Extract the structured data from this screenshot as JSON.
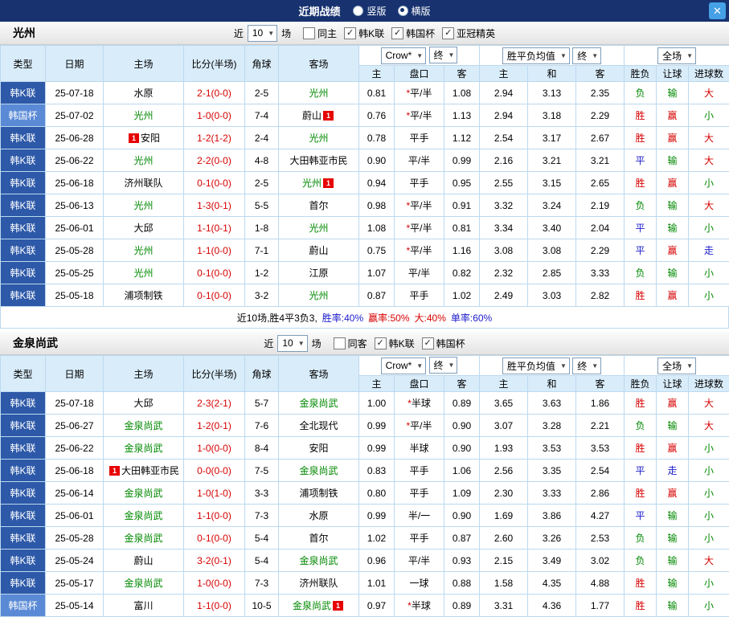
{
  "icons": {
    "chevron_down": "▼",
    "close": "✕",
    "check": "✓"
  },
  "colors": {
    "topbar_bg": "#17326f",
    "close_btn": "#45a0e6",
    "header_bg": "#d9ecfa",
    "border": "#bcd9ef",
    "league": {
      "韩K联": "#2d59a8",
      "韩国杯": "#5a8ad6"
    },
    "team_highlight": "#008800",
    "score": "#d60000",
    "card_badge": "#e60000",
    "outcome": {
      "胜": "#d60000",
      "赢": "#d60000",
      "大": "#d60000",
      "平": "#1b1bcc",
      "走": "#1b1bcc",
      "负": "#008800",
      "输": "#008800",
      "小": "#008800"
    }
  },
  "topbar": {
    "title": "近期战绩",
    "layout_options": [
      {
        "label": "竖版",
        "selected": false
      },
      {
        "label": "横版",
        "selected": true
      }
    ],
    "close_label": "✕"
  },
  "table_header": {
    "main_columns": [
      "类型",
      "日期",
      "主场",
      "比分(半场)",
      "角球",
      "客场"
    ],
    "sub_columns": [
      "主",
      "盘口",
      "客",
      "主",
      "和",
      "客",
      "胜负",
      "让球",
      "进球数"
    ]
  },
  "sections": [
    {
      "team": "光州",
      "filter": {
        "prefix": "近",
        "count": "10",
        "suffix": "场",
        "checkboxes": [
          {
            "label": "同主",
            "checked": false
          },
          {
            "label": "韩K联",
            "checked": true
          },
          {
            "label": "韩国杯",
            "checked": true
          },
          {
            "label": "亚冠精英",
            "checked": true
          }
        ]
      },
      "controls": {
        "odds_company": "Crow*",
        "odds_stage": "终",
        "avg_label": "胜平负均值",
        "avg_stage": "终",
        "scope": "全场"
      },
      "rows": [
        {
          "league": "韩K联",
          "date": "25-07-18",
          "home": {
            "name": "水原",
            "hl": false
          },
          "score": "2-1(0-0)",
          "corners": "2-5",
          "away": {
            "name": "光州",
            "hl": true
          },
          "odds": [
            "0.81",
            "*平/半",
            "1.08"
          ],
          "avg": [
            "2.94",
            "3.13",
            "2.35"
          ],
          "outcome": [
            "负",
            "输",
            "大"
          ]
        },
        {
          "league": "韩国杯",
          "date": "25-07-02",
          "home": {
            "name": "光州",
            "hl": true
          },
          "score": "1-0(0-0)",
          "corners": "7-4",
          "away": {
            "name": "蔚山",
            "hl": false,
            "card": "1",
            "card_pos": "after"
          },
          "odds": [
            "0.76",
            "*平/半",
            "1.13"
          ],
          "avg": [
            "2.94",
            "3.18",
            "2.29"
          ],
          "outcome": [
            "胜",
            "赢",
            "小"
          ]
        },
        {
          "league": "韩K联",
          "date": "25-06-28",
          "home": {
            "name": "安阳",
            "hl": false,
            "card": "1",
            "card_pos": "before"
          },
          "score": "1-2(1-2)",
          "corners": "2-4",
          "away": {
            "name": "光州",
            "hl": true
          },
          "odds": [
            "0.78",
            "平手",
            "1.12"
          ],
          "avg": [
            "2.54",
            "3.17",
            "2.67"
          ],
          "outcome": [
            "胜",
            "赢",
            "大"
          ]
        },
        {
          "league": "韩K联",
          "date": "25-06-22",
          "home": {
            "name": "光州",
            "hl": true
          },
          "score": "2-2(0-0)",
          "corners": "4-8",
          "away": {
            "name": "大田韩亚市民",
            "hl": false
          },
          "odds": [
            "0.90",
            "平/半",
            "0.99"
          ],
          "avg": [
            "2.16",
            "3.21",
            "3.21"
          ],
          "outcome": [
            "平",
            "输",
            "大"
          ]
        },
        {
          "league": "韩K联",
          "date": "25-06-18",
          "home": {
            "name": "济州联队",
            "hl": false
          },
          "score": "0-1(0-0)",
          "corners": "2-5",
          "away": {
            "name": "光州",
            "hl": true,
            "card": "1",
            "card_pos": "after"
          },
          "odds": [
            "0.94",
            "平手",
            "0.95"
          ],
          "avg": [
            "2.55",
            "3.15",
            "2.65"
          ],
          "outcome": [
            "胜",
            "赢",
            "小"
          ]
        },
        {
          "league": "韩K联",
          "date": "25-06-13",
          "home": {
            "name": "光州",
            "hl": true
          },
          "score": "1-3(0-1)",
          "corners": "5-5",
          "away": {
            "name": "首尔",
            "hl": false
          },
          "odds": [
            "0.98",
            "*平/半",
            "0.91"
          ],
          "avg": [
            "3.32",
            "3.24",
            "2.19"
          ],
          "outcome": [
            "负",
            "输",
            "大"
          ]
        },
        {
          "league": "韩K联",
          "date": "25-06-01",
          "home": {
            "name": "大邱",
            "hl": false
          },
          "score": "1-1(0-1)",
          "corners": "1-8",
          "away": {
            "name": "光州",
            "hl": true
          },
          "odds": [
            "1.08",
            "*平/半",
            "0.81"
          ],
          "avg": [
            "3.34",
            "3.40",
            "2.04"
          ],
          "outcome": [
            "平",
            "输",
            "小"
          ]
        },
        {
          "league": "韩K联",
          "date": "25-05-28",
          "home": {
            "name": "光州",
            "hl": true
          },
          "score": "1-1(0-0)",
          "corners": "7-1",
          "away": {
            "name": "蔚山",
            "hl": false
          },
          "odds": [
            "0.75",
            "*平/半",
            "1.16"
          ],
          "avg": [
            "3.08",
            "3.08",
            "2.29"
          ],
          "outcome": [
            "平",
            "赢",
            "走"
          ]
        },
        {
          "league": "韩K联",
          "date": "25-05-25",
          "home": {
            "name": "光州",
            "hl": true
          },
          "score": "0-1(0-0)",
          "corners": "1-2",
          "away": {
            "name": "江原",
            "hl": false
          },
          "odds": [
            "1.07",
            "平/半",
            "0.82"
          ],
          "avg": [
            "2.32",
            "2.85",
            "3.33"
          ],
          "outcome": [
            "负",
            "输",
            "小"
          ]
        },
        {
          "league": "韩K联",
          "date": "25-05-18",
          "home": {
            "name": "浦项制铁",
            "hl": false
          },
          "score": "0-1(0-0)",
          "corners": "3-2",
          "away": {
            "name": "光州",
            "hl": true
          },
          "odds": [
            "0.87",
            "平手",
            "1.02"
          ],
          "avg": [
            "2.49",
            "3.03",
            "2.82"
          ],
          "outcome": [
            "胜",
            "赢",
            "小"
          ]
        }
      ],
      "summary": [
        {
          "text": "近10场,胜4平3负3,",
          "color": "#000000"
        },
        {
          "text": "胜率:40%",
          "color": "#1b1bcc"
        },
        {
          "text": "赢率:50%",
          "color": "#d60000"
        },
        {
          "text": "大:40%",
          "color": "#d60000"
        },
        {
          "text": "单率:60%",
          "color": "#1b1bcc"
        }
      ]
    },
    {
      "team": "金泉尚武",
      "filter": {
        "prefix": "近",
        "count": "10",
        "suffix": "场",
        "checkboxes": [
          {
            "label": "同客",
            "checked": false
          },
          {
            "label": "韩K联",
            "checked": true
          },
          {
            "label": "韩国杯",
            "checked": true
          }
        ]
      },
      "controls": {
        "odds_company": "Crow*",
        "odds_stage": "终",
        "avg_label": "胜平负均值",
        "avg_stage": "终",
        "scope": "全场"
      },
      "rows": [
        {
          "league": "韩K联",
          "date": "25-07-18",
          "home": {
            "name": "大邱",
            "hl": false
          },
          "score": "2-3(2-1)",
          "corners": "5-7",
          "away": {
            "name": "金泉尚武",
            "hl": true
          },
          "odds": [
            "1.00",
            "*半球",
            "0.89"
          ],
          "avg": [
            "3.65",
            "3.63",
            "1.86"
          ],
          "outcome": [
            "胜",
            "赢",
            "大"
          ]
        },
        {
          "league": "韩K联",
          "date": "25-06-27",
          "home": {
            "name": "金泉尚武",
            "hl": true
          },
          "score": "1-2(0-1)",
          "corners": "7-6",
          "away": {
            "name": "全北现代",
            "hl": false
          },
          "odds": [
            "0.99",
            "*平/半",
            "0.90"
          ],
          "avg": [
            "3.07",
            "3.28",
            "2.21"
          ],
          "outcome": [
            "负",
            "输",
            "大"
          ]
        },
        {
          "league": "韩K联",
          "date": "25-06-22",
          "home": {
            "name": "金泉尚武",
            "hl": true
          },
          "score": "1-0(0-0)",
          "corners": "8-4",
          "away": {
            "name": "安阳",
            "hl": false
          },
          "odds": [
            "0.99",
            "半球",
            "0.90"
          ],
          "avg": [
            "1.93",
            "3.53",
            "3.53"
          ],
          "outcome": [
            "胜",
            "赢",
            "小"
          ]
        },
        {
          "league": "韩K联",
          "date": "25-06-18",
          "home": {
            "name": "大田韩亚市民",
            "hl": false,
            "card": "1",
            "card_pos": "before"
          },
          "score": "0-0(0-0)",
          "corners": "7-5",
          "away": {
            "name": "金泉尚武",
            "hl": true
          },
          "odds": [
            "0.83",
            "平手",
            "1.06"
          ],
          "avg": [
            "2.56",
            "3.35",
            "2.54"
          ],
          "outcome": [
            "平",
            "走",
            "小"
          ]
        },
        {
          "league": "韩K联",
          "date": "25-06-14",
          "home": {
            "name": "金泉尚武",
            "hl": true
          },
          "score": "1-0(1-0)",
          "corners": "3-3",
          "away": {
            "name": "浦项制铁",
            "hl": false
          },
          "odds": [
            "0.80",
            "平手",
            "1.09"
          ],
          "avg": [
            "2.30",
            "3.33",
            "2.86"
          ],
          "outcome": [
            "胜",
            "赢",
            "小"
          ]
        },
        {
          "league": "韩K联",
          "date": "25-06-01",
          "home": {
            "name": "金泉尚武",
            "hl": true
          },
          "score": "1-1(0-0)",
          "corners": "7-3",
          "away": {
            "name": "水原",
            "hl": false
          },
          "odds": [
            "0.99",
            "半/一",
            "0.90"
          ],
          "avg": [
            "1.69",
            "3.86",
            "4.27"
          ],
          "outcome": [
            "平",
            "输",
            "小"
          ]
        },
        {
          "league": "韩K联",
          "date": "25-05-28",
          "home": {
            "name": "金泉尚武",
            "hl": true
          },
          "score": "0-1(0-0)",
          "corners": "5-4",
          "away": {
            "name": "首尔",
            "hl": false
          },
          "odds": [
            "1.02",
            "平手",
            "0.87"
          ],
          "avg": [
            "2.60",
            "3.26",
            "2.53"
          ],
          "outcome": [
            "负",
            "输",
            "小"
          ]
        },
        {
          "league": "韩K联",
          "date": "25-05-24",
          "home": {
            "name": "蔚山",
            "hl": false
          },
          "score": "3-2(0-1)",
          "corners": "5-4",
          "away": {
            "name": "金泉尚武",
            "hl": true
          },
          "odds": [
            "0.96",
            "平/半",
            "0.93"
          ],
          "avg": [
            "2.15",
            "3.49",
            "3.02"
          ],
          "outcome": [
            "负",
            "输",
            "大"
          ]
        },
        {
          "league": "韩K联",
          "date": "25-05-17",
          "home": {
            "name": "金泉尚武",
            "hl": true
          },
          "score": "1-0(0-0)",
          "corners": "7-3",
          "away": {
            "name": "济州联队",
            "hl": false
          },
          "odds": [
            "1.01",
            "一球",
            "0.88"
          ],
          "avg": [
            "1.58",
            "4.35",
            "4.88"
          ],
          "outcome": [
            "胜",
            "输",
            "小"
          ]
        },
        {
          "league": "韩国杯",
          "date": "25-05-14",
          "home": {
            "name": "富川",
            "hl": false
          },
          "score": "1-1(0-0)",
          "corners": "10-5",
          "away": {
            "name": "金泉尚武",
            "hl": true,
            "card": "1",
            "card_pos": "after"
          },
          "odds": [
            "0.97",
            "*半球",
            "0.89"
          ],
          "avg": [
            "3.31",
            "4.36",
            "1.77"
          ],
          "outcome": [
            "胜",
            "输",
            "小"
          ]
        }
      ]
    }
  ]
}
